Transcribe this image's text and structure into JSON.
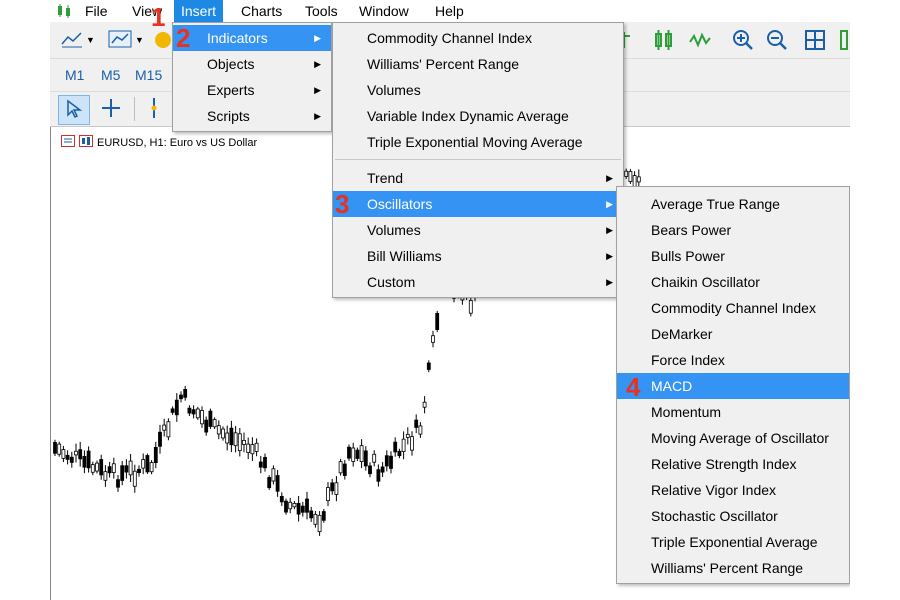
{
  "menubar": {
    "items": [
      "File",
      "View",
      "Insert",
      "Charts",
      "Tools",
      "Window",
      "Help"
    ]
  },
  "toolbar": {
    "timeframes": [
      "M1",
      "M5",
      "M15"
    ]
  },
  "chart": {
    "title": "EURUSD, H1:  Euro vs US Dollar"
  },
  "insert_menu": {
    "items": [
      "Indicators",
      "Objects",
      "Experts",
      "Scripts"
    ]
  },
  "indicators_menu": {
    "top_items": [
      "Commodity Channel Index",
      "Williams' Percent Range",
      "Volumes",
      "Variable Index Dynamic Average",
      "Triple Exponential Moving Average"
    ],
    "groups": [
      "Trend",
      "Oscillators",
      "Volumes",
      "Bill Williams",
      "Custom"
    ]
  },
  "oscillators_menu": {
    "items": [
      "Average True Range",
      "Bears Power",
      "Bulls Power",
      "Chaikin Oscillator",
      "Commodity Channel Index",
      "DeMarker",
      "Force Index",
      "MACD",
      "Momentum",
      "Moving Average of Oscillator",
      "Relative Strength Index",
      "Relative Vigor Index",
      "Stochastic Oscillator",
      "Triple Exponential Average",
      "Williams' Percent Range"
    ]
  },
  "steps": [
    "1",
    "2",
    "3",
    "4"
  ],
  "colors": {
    "highlight": "#3593f4",
    "active_menu": "#1e88e5",
    "step_marker": "#e53221",
    "toolbar_icon": "#1a5fa8"
  }
}
